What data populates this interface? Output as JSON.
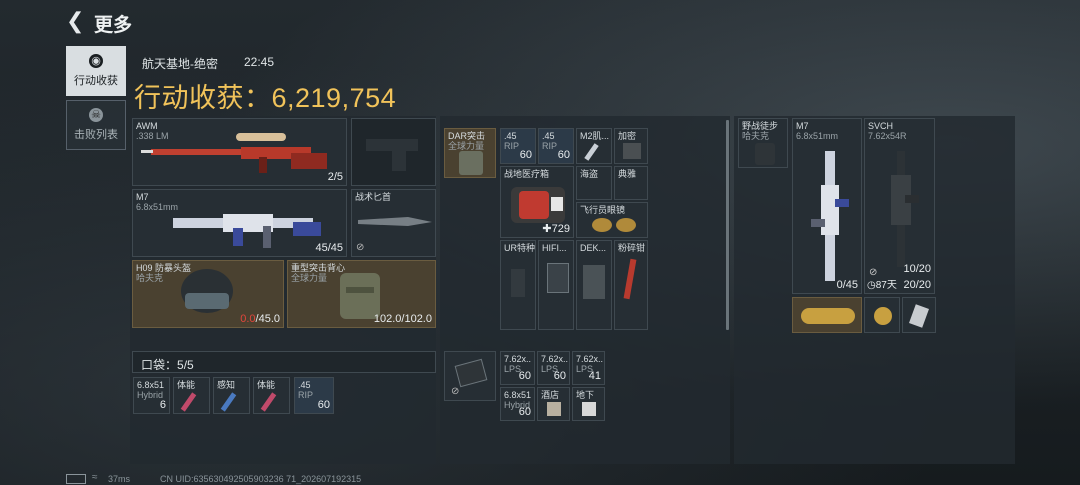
{
  "header": {
    "title": "更多",
    "back_icon": "back-arrow-icon"
  },
  "sidebar": {
    "tabs": [
      {
        "label": "行动收获",
        "icon": "loot-icon",
        "active": true
      },
      {
        "label": "击败列表",
        "icon": "skull-icon",
        "active": false
      }
    ]
  },
  "info": {
    "map": "航天基地-绝密",
    "time": "22:45",
    "harvest_label": "行动收获：",
    "harvest_value": "6,219,754"
  },
  "loadout": {
    "primary1": {
      "name": "AWM",
      "caliber": ".338 LM",
      "ammo": "2/5"
    },
    "primary2": {
      "name": "M7",
      "caliber": "6.8x51mm",
      "ammo": "45/45"
    },
    "knife": {
      "name": "战术匕首"
    },
    "helmet": {
      "name": "H09 防暴头盔",
      "brand": "哈夫克",
      "dur_cur": "0.0",
      "dur_max": "/45.0"
    },
    "armor": {
      "name": "重型突击背心",
      "brand": "全球力量",
      "dur": "102.0/102.0"
    }
  },
  "pockets": {
    "label": "口袋：",
    "count": "5/5",
    "items": [
      {
        "l1": "6.8x51",
        "l2": "Hybrid",
        "n": "6"
      },
      {
        "l1": "体能",
        "l2": "",
        "n": ""
      },
      {
        "l1": "感知",
        "l2": "",
        "n": ""
      },
      {
        "l1": "体能",
        "l2": "",
        "n": ""
      },
      {
        "l1": ".45",
        "l2": "RIP",
        "n": "60"
      }
    ]
  },
  "chest": {
    "rig": {
      "l1": "DAR突击",
      "l2": "全球力量"
    },
    "ammo_a": {
      "l1": ".45",
      "l2": "RIP",
      "n": "60"
    },
    "ammo_b": {
      "l1": ".45",
      "l2": "RIP",
      "n": "60"
    },
    "m2": {
      "l1": "M2肌..."
    },
    "add": {
      "l1": "加密"
    },
    "medkit": {
      "l1": "战地医疗箱",
      "n": "729"
    },
    "sea": {
      "l1": "海盗"
    },
    "classic": {
      "l1": "典雅"
    },
    "goggles": {
      "l1": "飞行员眼镜"
    },
    "ur": {
      "l1": "UR特种"
    },
    "hifi": {
      "l1": "HIFI..."
    },
    "dek": {
      "l1": "DEK..."
    },
    "plier": {
      "l1": "粉碎钳"
    }
  },
  "bag": {
    "ammo1": {
      "l1": "7.62x..",
      "l2": "LPS",
      "n": "60"
    },
    "ammo2": {
      "l1": "7.62x..",
      "l2": "LPS",
      "n": "60"
    },
    "ammo3": {
      "l1": "7.62x..",
      "l2": "LPS",
      "n": "41"
    },
    "ammo4": {
      "l1": "6.8x51",
      "l2": "Hybrid",
      "n": "60"
    },
    "ammo5": {
      "l1": "酒店"
    },
    "ammo6": {
      "l1": "地下"
    }
  },
  "safe": {
    "l1": "野战徒步",
    "l2": "哈夫克"
  },
  "guns": {
    "m7": {
      "name": "M7",
      "caliber": "6.8x51mm",
      "ammo": "0/45"
    },
    "svch": {
      "name": "SVCH",
      "caliber": "7.62x54R",
      "ammo": "20/20",
      "mag": "10/20",
      "timer": "87天"
    }
  },
  "footer": {
    "ping": "37ms",
    "uid": "CN UID:635630492505903236 71_202607192315"
  },
  "colors": {
    "accent": "#f1c35a",
    "damage": "#e2463c"
  }
}
